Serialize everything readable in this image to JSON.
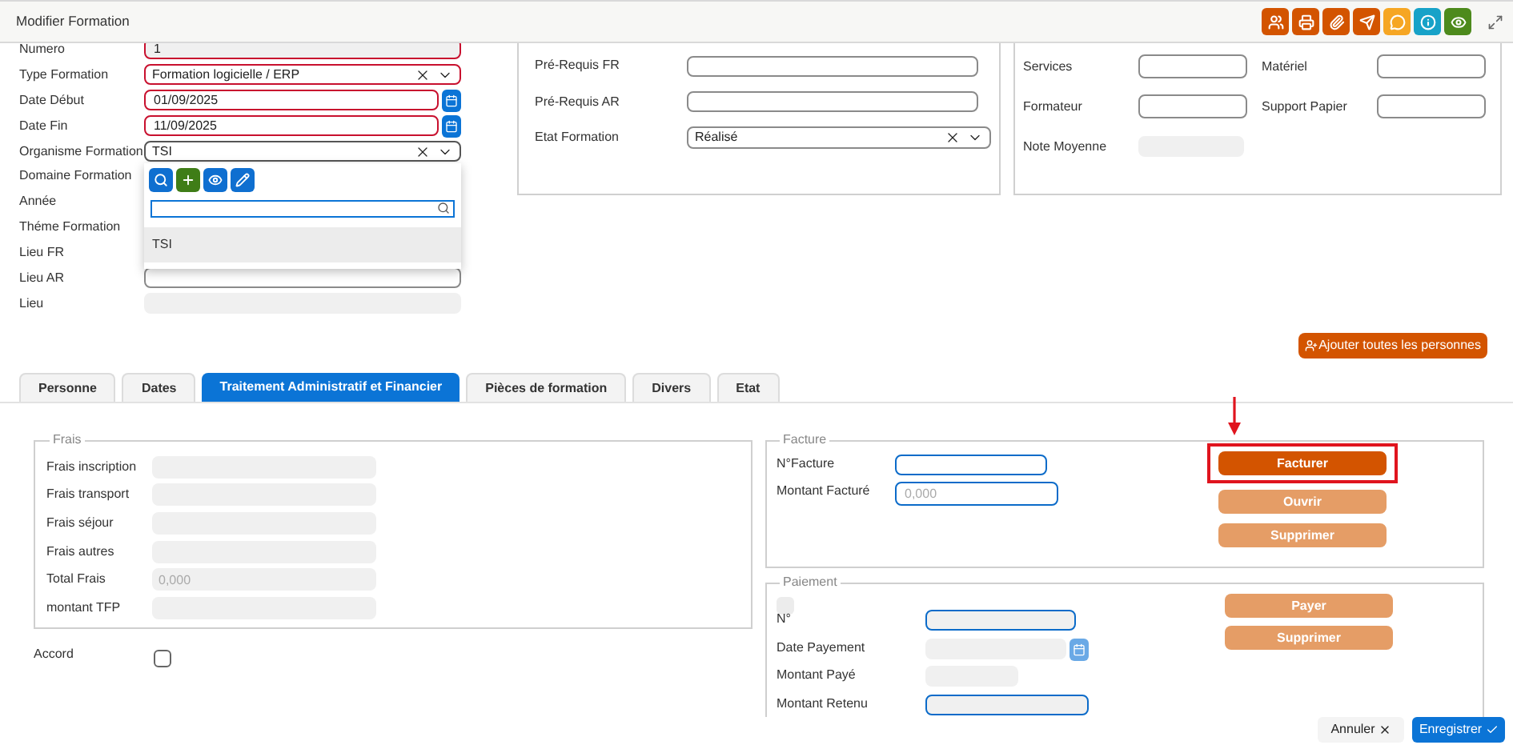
{
  "window": {
    "title": "Modifier Formation"
  },
  "toolbar": [
    {
      "kind": "people",
      "color": "#d35400"
    },
    {
      "kind": "print",
      "color": "#d35400"
    },
    {
      "kind": "attach",
      "color": "#d35400"
    },
    {
      "kind": "send",
      "color": "#d35400"
    },
    {
      "kind": "comment",
      "color": "#f6a623"
    },
    {
      "kind": "info",
      "color": "#17a2c8"
    },
    {
      "kind": "view",
      "color": "#4d8a1c"
    }
  ],
  "general": {
    "fields": [
      {
        "label": "Numero",
        "kind": "text",
        "value": "1",
        "required": true,
        "disabled": true
      },
      {
        "label": "Type Formation",
        "kind": "select",
        "value": "Formation logicielle / ERP",
        "required": true
      },
      {
        "label": "Date Début",
        "kind": "date",
        "value": "01/09/2025",
        "required": true
      },
      {
        "label": "Date Fin",
        "kind": "date",
        "value": "11/09/2025",
        "required": true
      },
      {
        "label": "Organisme Formation",
        "kind": "select",
        "value": "TSI",
        "required": false,
        "open": true
      },
      {
        "label": "Domaine Formation",
        "kind": "covered"
      },
      {
        "label": "Année",
        "kind": "covered"
      },
      {
        "label": "Théme Formation",
        "kind": "covered"
      },
      {
        "label": "Lieu FR",
        "kind": "covered"
      },
      {
        "label": "Lieu AR",
        "kind": "text",
        "required": false,
        "disabled": false
      },
      {
        "label": "Lieu",
        "kind": "text",
        "required": false,
        "disabled": true
      }
    ],
    "dropdown": {
      "tools": [
        {
          "kind": "search",
          "color": "#0f6fd0"
        },
        {
          "kind": "add",
          "color": "#3f7d17"
        },
        {
          "kind": "view",
          "color": "#0f6fd0"
        },
        {
          "kind": "edit",
          "color": "#0f6fd0"
        }
      ],
      "options": [
        {
          "label": "TSI",
          "selected": true
        }
      ]
    }
  },
  "prerequis": {
    "fields": [
      {
        "label": "Pré-Requis FR",
        "kind": "text"
      },
      {
        "label": "Pré-Requis AR",
        "kind": "text"
      },
      {
        "label": "Etat Formation",
        "kind": "select",
        "value": "Réalisé"
      }
    ]
  },
  "note": {
    "fields": [
      {
        "label": "Services",
        "disabled": false
      },
      {
        "label": "Matériel",
        "disabled": false
      },
      {
        "label": "Formateur",
        "disabled": false
      },
      {
        "label": "Support Papier",
        "disabled": false
      },
      {
        "label": "Note Moyenne",
        "disabled": true
      }
    ]
  },
  "add_all_button": "Ajouter toutes les personnes",
  "tabs": [
    {
      "label": "Personne",
      "selected": false
    },
    {
      "label": "Dates",
      "selected": false
    },
    {
      "label": "Traitement Administratif et Financier",
      "selected": true
    },
    {
      "label": "Pièces de formation",
      "selected": false
    },
    {
      "label": "Divers",
      "selected": false
    },
    {
      "label": "Etat",
      "selected": false
    }
  ],
  "frais": {
    "title": "Frais",
    "fields": [
      {
        "label": "Frais inscription",
        "disabled": true
      },
      {
        "label": "Frais transport",
        "disabled": true
      },
      {
        "label": "Frais séjour",
        "disabled": true
      },
      {
        "label": "Frais autres",
        "disabled": true
      },
      {
        "label": "Total Frais",
        "placeholder": "0,000",
        "disabled": true
      },
      {
        "label": "montant TFP",
        "disabled": true
      }
    ]
  },
  "accord": {
    "label": "Accord",
    "checked": false
  },
  "facture": {
    "title": "Facture",
    "fields": [
      {
        "label": "N°Facture",
        "highlighted": true
      },
      {
        "label": "Montant Facturé",
        "placeholder": "0,000",
        "highlighted": true
      }
    ],
    "buttons": [
      {
        "label": "Facturer",
        "disabled": false,
        "annotated": true
      },
      {
        "label": "Ouvrir",
        "disabled": true,
        "annotated": false
      },
      {
        "label": "Supprimer",
        "disabled": true,
        "annotated": false
      }
    ]
  },
  "paiement": {
    "title": "Paiement",
    "toggle": {
      "checked": false,
      "disabled": true
    },
    "fields": [
      {
        "label": "N°",
        "kind": "text",
        "highlighted": true
      },
      {
        "label": "Date Payement",
        "kind": "date",
        "highlighted": false
      },
      {
        "label": "Montant Payé",
        "kind": "text",
        "highlighted": false
      },
      {
        "label": "Montant Retenu",
        "kind": "text",
        "highlighted": true
      }
    ],
    "buttons": [
      {
        "label": "Payer",
        "disabled": true
      },
      {
        "label": "Supprimer",
        "disabled": true
      }
    ]
  },
  "footer": {
    "buttons": [
      {
        "label": "Annuler",
        "kind": "cancel"
      },
      {
        "label": "Enregistrer",
        "kind": "save"
      }
    ]
  }
}
